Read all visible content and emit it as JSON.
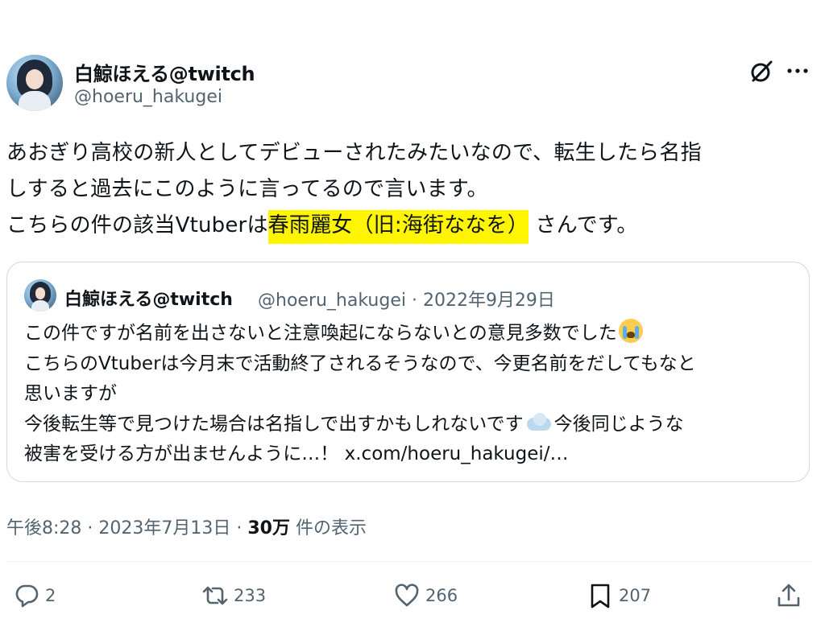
{
  "author": {
    "display_name": "白鯨ほえる@twitch",
    "handle": "@hoeru_hakugei"
  },
  "tweet": {
    "lines": [
      "あおぎり高校の新人としてデビューされたみたいなので、転生したら名指",
      "しすると過去にこのように言ってるので言います。"
    ],
    "line3_before": "こちらの件の該当Vtuberは",
    "line3_highlight": "春雨麗女（旧:海街ななを）",
    "line3_after": " さんです。",
    "highlight_color": "#fff500"
  },
  "quote": {
    "display_name": "白鯨ほえる@twitch",
    "meta": "@hoeru_hakugei · 2022年9月29日",
    "line1": "この件ですが名前を出さないと注意喚起にならないとの意見多数でした",
    "line1_emoji": "loudly-crying-face-emoji",
    "line2": "こちらのVtuberは今月末で活動終了されるそうなので、今更名前をだしてもなと",
    "line3": "思いますが",
    "line4_a": "今後転生等で見つけた場合は名指しで出すかもしれないです",
    "line4_emoji": "thought-balloon-emoji",
    "line4_b": "今後同じような",
    "line5": "被害を受ける方が出ませんように…！ x.com/hoeru_hakugei/…"
  },
  "meta": {
    "time": "午後8:28 · 2023年7月13日 · ",
    "views_count": "30万",
    "views_label": " 件の表示"
  },
  "actions": {
    "replies": "2",
    "reposts": "233",
    "likes": "266",
    "bookmarks": "207"
  },
  "icons": [
    "grok-icon",
    "more-icon",
    "reply-icon",
    "repost-icon",
    "like-icon",
    "bookmark-icon",
    "share-icon"
  ],
  "colors": {
    "text": "#0f1419",
    "secondary": "#536471",
    "border": "#cfd9de"
  }
}
